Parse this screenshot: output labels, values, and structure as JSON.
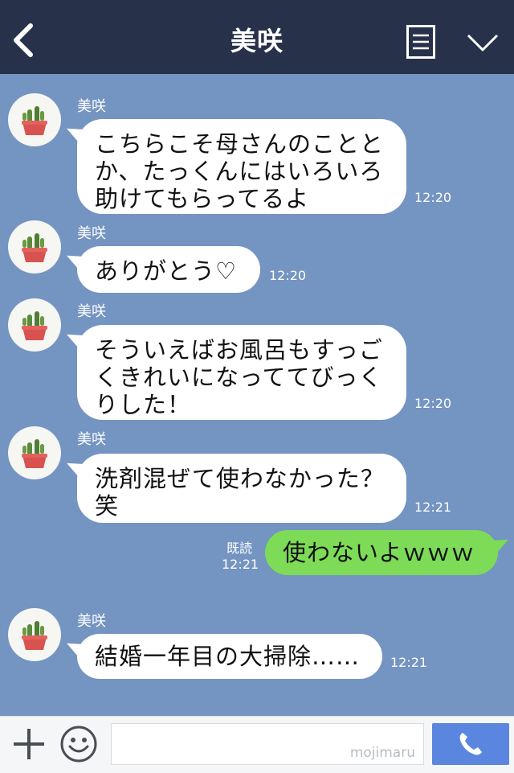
{
  "header": {
    "title": "美咲",
    "back_icon": "chevron-left-icon",
    "menu_icon": "menu-list-icon",
    "collapse_icon": "chevron-down-icon"
  },
  "messages": [
    {
      "from": "contact",
      "sender": "美咲",
      "text": "こちらこそ母さんのことと\nか、たっくんにはいろいろ\n助けてもらってるよ",
      "time": "12:20"
    },
    {
      "from": "contact",
      "sender": "美咲",
      "text": "ありがとう♡",
      "time": "12:20"
    },
    {
      "from": "contact",
      "sender": "美咲",
      "text": "そういえばお風呂もすっご\nくきれいになっててびっく\nりした！",
      "time": "12:20"
    },
    {
      "from": "contact",
      "sender": "美咲",
      "text": "洗剤混ぜて使わなかった？\n笑",
      "time": "12:21"
    },
    {
      "from": "me",
      "text": "使わないよｗｗｗ",
      "read_label": "既読",
      "time": "12:21"
    },
    {
      "from": "contact",
      "sender": "美咲",
      "text": "結婚一年目の大掃除……",
      "time": "12:21"
    }
  ],
  "footer": {
    "plus_icon": "plus-icon",
    "emoji_icon": "smile-icon",
    "input_value": "",
    "watermark": "mojimaru",
    "call_icon": "phone-icon"
  },
  "colors": {
    "header_bg": "#27324a",
    "chat_bg": "#7494c2",
    "my_bubble": "#7ddb57",
    "contact_bubble": "#ffffff",
    "call_button": "#5b86df"
  }
}
